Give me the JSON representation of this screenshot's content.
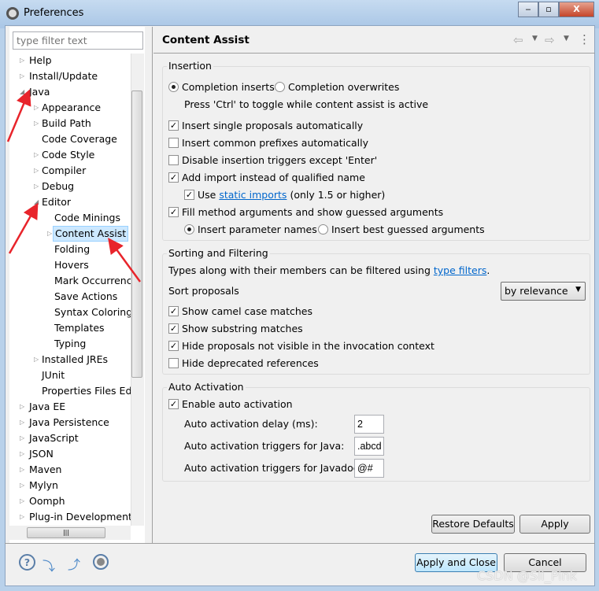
{
  "window": {
    "title": "Preferences",
    "minimize": "‒",
    "maximize": "▫",
    "close": "X"
  },
  "filter": {
    "placeholder": "type filter text"
  },
  "tree": [
    {
      "label": "Help",
      "level": 0,
      "arrow": "right"
    },
    {
      "label": "Install/Update",
      "level": 0,
      "arrow": "right"
    },
    {
      "label": "Java",
      "level": 0,
      "arrow": "down"
    },
    {
      "label": "Appearance",
      "level": 1,
      "arrow": "right"
    },
    {
      "label": "Build Path",
      "level": 1,
      "arrow": "right"
    },
    {
      "label": "Code Coverage",
      "level": 1,
      "arrow": ""
    },
    {
      "label": "Code Style",
      "level": 1,
      "arrow": "right"
    },
    {
      "label": "Compiler",
      "level": 1,
      "arrow": "right"
    },
    {
      "label": "Debug",
      "level": 1,
      "arrow": "right"
    },
    {
      "label": "Editor",
      "level": 1,
      "arrow": "down"
    },
    {
      "label": "Code Minings",
      "level": 2,
      "arrow": ""
    },
    {
      "label": "Content Assist",
      "level": 2,
      "arrow": "right",
      "selected": true
    },
    {
      "label": "Folding",
      "level": 2,
      "arrow": ""
    },
    {
      "label": "Hovers",
      "level": 2,
      "arrow": ""
    },
    {
      "label": "Mark Occurrences",
      "level": 2,
      "arrow": ""
    },
    {
      "label": "Save Actions",
      "level": 2,
      "arrow": ""
    },
    {
      "label": "Syntax Coloring",
      "level": 2,
      "arrow": ""
    },
    {
      "label": "Templates",
      "level": 2,
      "arrow": ""
    },
    {
      "label": "Typing",
      "level": 2,
      "arrow": ""
    },
    {
      "label": "Installed JREs",
      "level": 1,
      "arrow": "right"
    },
    {
      "label": "JUnit",
      "level": 1,
      "arrow": ""
    },
    {
      "label": "Properties Files Editor",
      "level": 1,
      "arrow": ""
    },
    {
      "label": "Java EE",
      "level": 0,
      "arrow": "right"
    },
    {
      "label": "Java Persistence",
      "level": 0,
      "arrow": "right"
    },
    {
      "label": "JavaScript",
      "level": 0,
      "arrow": "right"
    },
    {
      "label": "JSON",
      "level": 0,
      "arrow": "right"
    },
    {
      "label": "Maven",
      "level": 0,
      "arrow": "right"
    },
    {
      "label": "Mylyn",
      "level": 0,
      "arrow": "right"
    },
    {
      "label": "Oomph",
      "level": 0,
      "arrow": "right"
    },
    {
      "label": "Plug-in Development",
      "level": 0,
      "arrow": "right"
    }
  ],
  "page": {
    "title": "Content Assist",
    "back": "⇦",
    "forward": "⇨",
    "menu": "⋮"
  },
  "insertion": {
    "label": "Insertion",
    "radio_inserts": "Completion inserts",
    "radio_overwrites": "Completion overwrites",
    "hint": "Press 'Ctrl' to toggle while content assist is active",
    "single": "Insert single proposals automatically",
    "prefixes": "Insert common prefixes automatically",
    "disable_triggers": "Disable insertion triggers except 'Enter'",
    "add_import": "Add import instead of qualified name",
    "use": "Use",
    "static_imports": "static imports",
    "only15": "(only 1.5 or higher)",
    "fill_args": "Fill method arguments and show guessed arguments",
    "param_names": "Insert parameter names",
    "best_guessed": "Insert best guessed arguments"
  },
  "sorting": {
    "label": "Sorting and Filtering",
    "types_text": "Types along with their members can be filtered using",
    "type_filters": "type filters",
    "period": ".",
    "sort_label": "Sort proposals",
    "sort_value": "by relevance",
    "camel": "Show camel case matches",
    "substring": "Show substring matches",
    "hide_invisible": "Hide proposals not visible in the invocation context",
    "hide_deprecated": "Hide deprecated references"
  },
  "auto": {
    "label": "Auto Activation",
    "enable": "Enable auto activation",
    "delay_label": "Auto activation delay (ms):",
    "delay": "2",
    "java_label": "Auto activation triggers for Java:",
    "java": ".abcd",
    "javadoc_label": "Auto activation triggers for Javadoc:",
    "javadoc": "@#"
  },
  "buttons": {
    "restore": "Restore Defaults",
    "apply": "Apply",
    "apply_close": "Apply and Close",
    "cancel": "Cancel"
  },
  "watermark": "CSDN @Sli_Pink",
  "colors": {
    "link": "#0066cc",
    "annotation": "#e8242b",
    "selection": "#cce8ff"
  }
}
